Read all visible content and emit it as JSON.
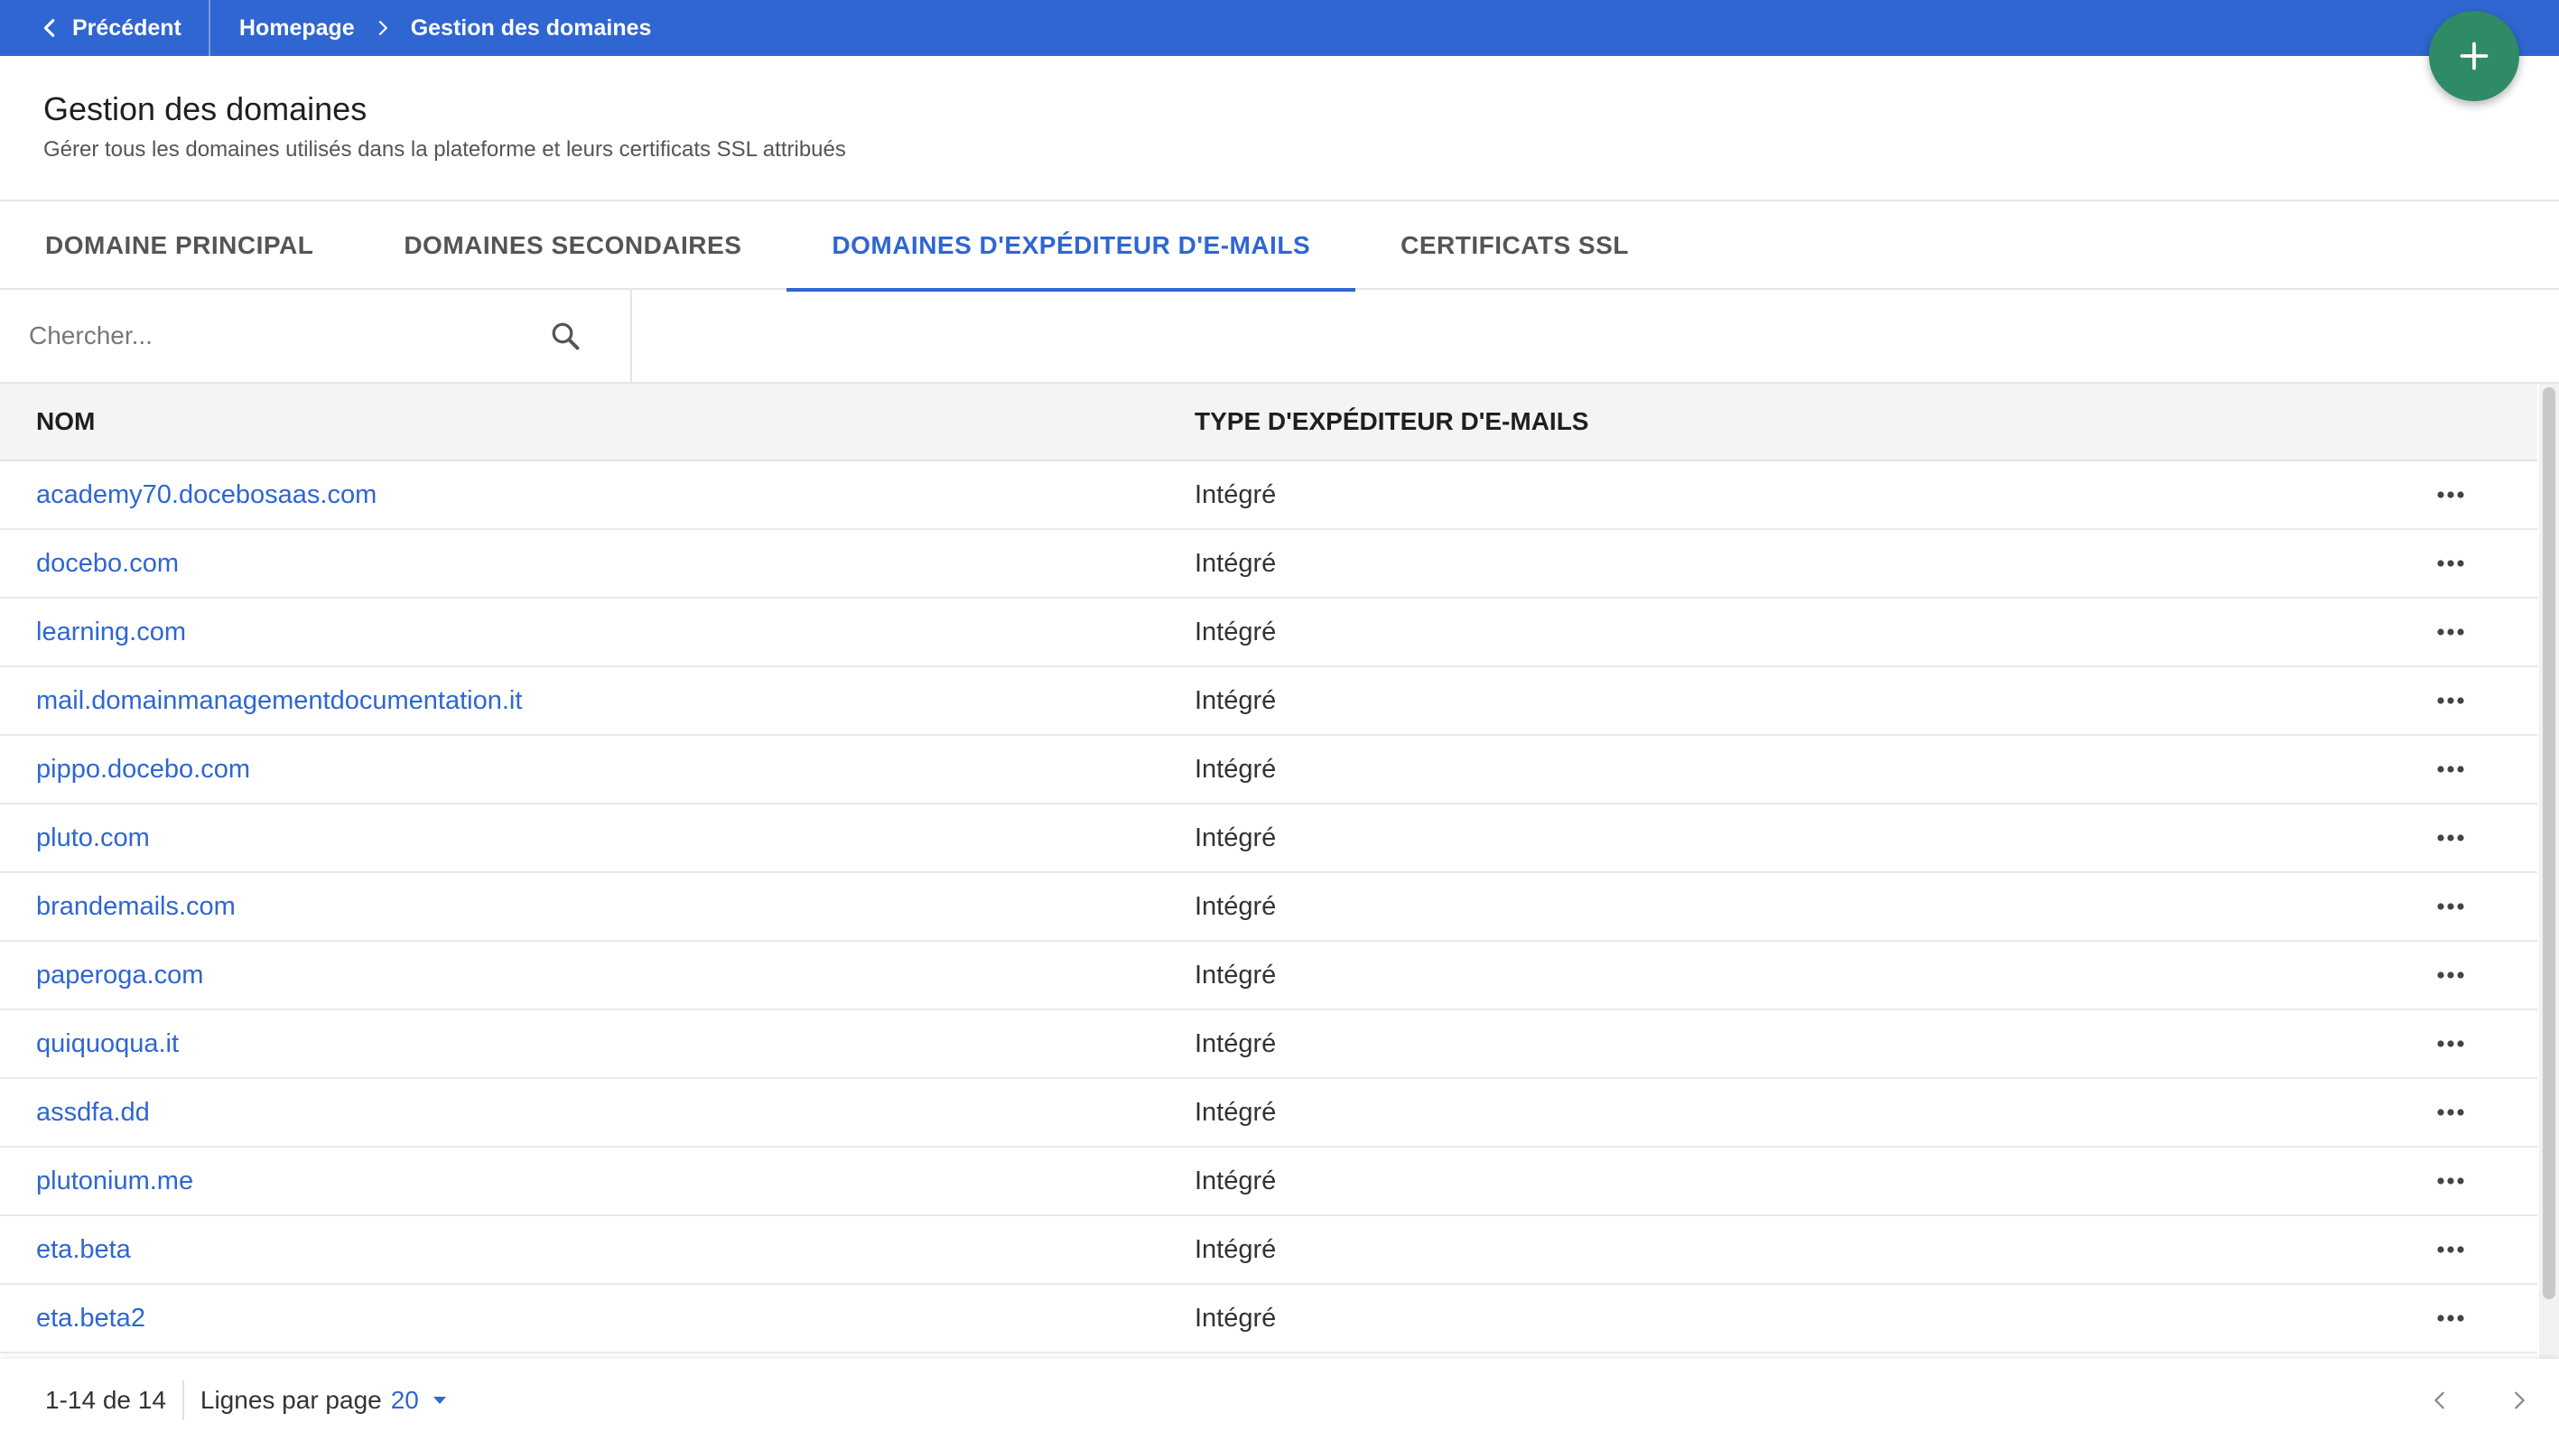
{
  "topbar": {
    "back_label": "Précédent",
    "breadcrumb": [
      {
        "label": "Homepage"
      },
      {
        "label": "Gestion des domaines"
      }
    ],
    "color": "#2f66d1"
  },
  "fab": {
    "icon": "plus-icon",
    "color": "#2f8a66"
  },
  "header": {
    "title": "Gestion des domaines",
    "subtitle": "Gérer tous les domaines utilisés dans la plateforme et leurs certificats SSL attribués"
  },
  "tabs": [
    {
      "label": "DOMAINE PRINCIPAL",
      "active": false
    },
    {
      "label": "DOMAINES SECONDAIRES",
      "active": false
    },
    {
      "label": "DOMAINES D'EXPÉDITEUR D'E-MAILS",
      "active": true
    },
    {
      "label": "CERTIFICATS SSL",
      "active": false
    }
  ],
  "search": {
    "placeholder": "Chercher...",
    "value": "",
    "icon": "search-icon"
  },
  "table": {
    "columns": [
      "NOM",
      "TYPE D'EXPÉDITEUR D'E-MAILS"
    ],
    "rows": [
      {
        "name": "academy70.docebosaas.com",
        "type": "Intégré"
      },
      {
        "name": "docebo.com",
        "type": "Intégré"
      },
      {
        "name": "learning.com",
        "type": "Intégré"
      },
      {
        "name": "mail.domainmanagementdocumentation.it",
        "type": "Intégré"
      },
      {
        "name": "pippo.docebo.com",
        "type": "Intégré"
      },
      {
        "name": "pluto.com",
        "type": "Intégré"
      },
      {
        "name": "brandemails.com",
        "type": "Intégré"
      },
      {
        "name": "paperoga.com",
        "type": "Intégré"
      },
      {
        "name": "quiquoqua.it",
        "type": "Intégré"
      },
      {
        "name": "assdfa.dd",
        "type": "Intégré"
      },
      {
        "name": "plutonium.me",
        "type": "Intégré"
      },
      {
        "name": "eta.beta",
        "type": "Intégré"
      },
      {
        "name": "eta.beta2",
        "type": "Intégré"
      }
    ],
    "link_color": "#2f66d1"
  },
  "footer": {
    "range": "1-14 de 14",
    "rows_per_page_label": "Lignes par page",
    "rows_per_page_value": "20"
  }
}
